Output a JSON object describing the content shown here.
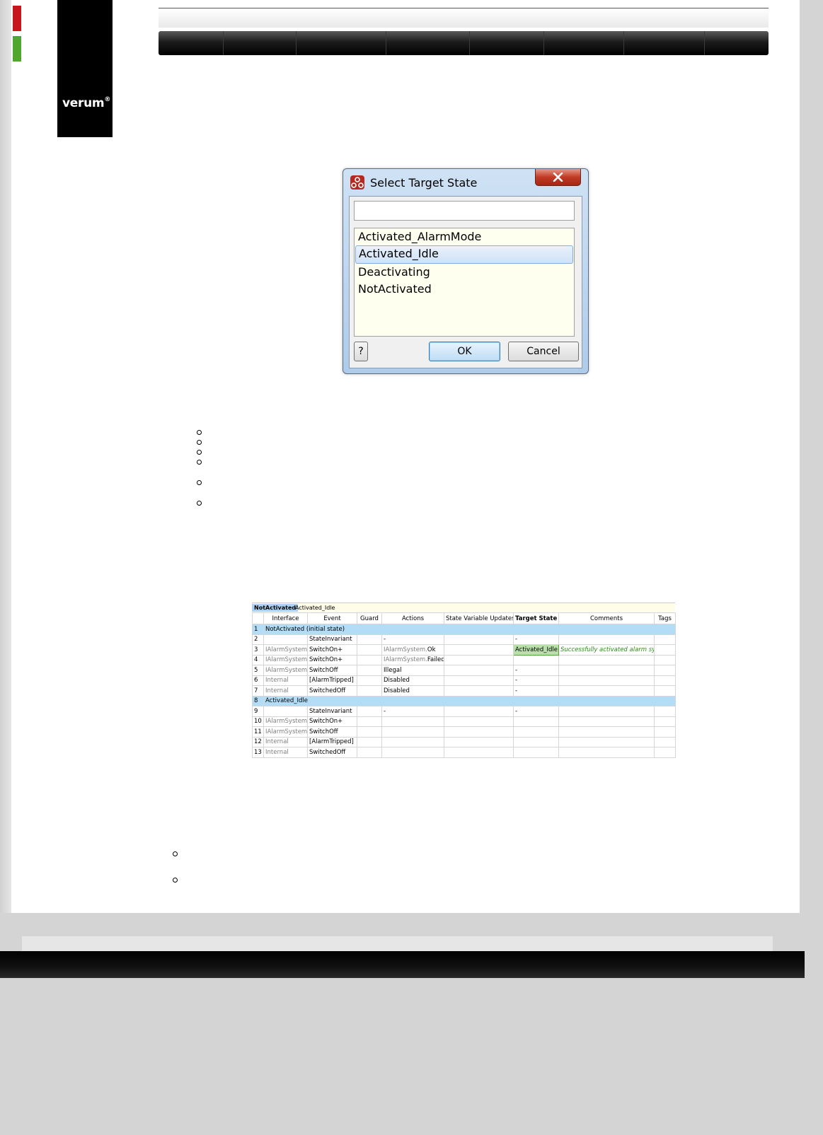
{
  "brand": {
    "logo_text": "verum",
    "logo_reg": "®"
  },
  "dialog": {
    "title": "Select Target State",
    "search_value": "",
    "states": [
      "Activated_AlarmMode",
      "Activated_Idle",
      "Deactivating",
      "NotActivated"
    ],
    "selected_state": "Activated_Idle",
    "help_label": "?",
    "ok_label": "OK",
    "cancel_label": "Cancel"
  },
  "sheet": {
    "tabs": [
      "NotActivated",
      "Activated_Idle"
    ],
    "columns": [
      "",
      "Interface",
      "Event",
      "Guard",
      "Actions",
      "State Variable Updates",
      "Target State",
      "Comments",
      "Tags"
    ],
    "rows": [
      {
        "num": "1",
        "section": "NotActivated (initial state)"
      },
      {
        "num": "2",
        "interface": "",
        "event": "StateInvariant",
        "guard": "",
        "actions": "-",
        "actions_prefix": "",
        "svu": "",
        "target": "-",
        "comment": "",
        "tags": ""
      },
      {
        "num": "3",
        "interface": "IAlarmSystem",
        "event": "SwitchOn+",
        "guard": "",
        "actions_prefix": "IAlarmSystem.",
        "actions": "Ok",
        "svu": "",
        "target": "Activated_Idle",
        "target_highlight": true,
        "comment": "Successfully activated alarm system",
        "tags": ""
      },
      {
        "num": "4",
        "interface": "IAlarmSystem",
        "event": "SwitchOn+",
        "guard": "",
        "actions_prefix": "IAlarmSystem.",
        "actions": "Failed",
        "svu": "",
        "target": "",
        "comment": "",
        "tags": ""
      },
      {
        "num": "5",
        "interface": "IAlarmSystem",
        "event": "SwitchOff",
        "guard": "",
        "actions_prefix": "",
        "actions": "Illegal",
        "svu": "",
        "target": "-",
        "comment": "",
        "tags": ""
      },
      {
        "num": "6",
        "interface": "Internal",
        "event": "[AlarmTripped]",
        "guard": "",
        "actions_prefix": "",
        "actions": "Disabled",
        "svu": "",
        "target": "-",
        "comment": "",
        "tags": ""
      },
      {
        "num": "7",
        "interface": "Internal",
        "event": "SwitchedOff",
        "guard": "",
        "actions_prefix": "",
        "actions": "Disabled",
        "svu": "",
        "target": "-",
        "comment": "",
        "tags": ""
      },
      {
        "num": "8",
        "section": "Activated_Idle"
      },
      {
        "num": "9",
        "interface": "",
        "event": "StateInvariant",
        "guard": "",
        "actions_prefix": "",
        "actions": "-",
        "svu": "",
        "target": "-",
        "comment": "",
        "tags": ""
      },
      {
        "num": "10",
        "interface": "IAlarmSystem",
        "event": "SwitchOn+",
        "guard": "",
        "actions_prefix": "",
        "actions": "",
        "svu": "",
        "target": "",
        "comment": "",
        "tags": ""
      },
      {
        "num": "11",
        "interface": "IAlarmSystem",
        "event": "SwitchOff",
        "guard": "",
        "actions_prefix": "",
        "actions": "",
        "svu": "",
        "target": "",
        "comment": "",
        "tags": ""
      },
      {
        "num": "12",
        "interface": "Internal",
        "event": "[AlarmTripped]",
        "guard": "",
        "actions_prefix": "",
        "actions": "",
        "svu": "",
        "target": "",
        "comment": "",
        "tags": ""
      },
      {
        "num": "13",
        "interface": "Internal",
        "event": "SwitchedOff",
        "guard": "",
        "actions_prefix": "",
        "actions": "",
        "svu": "",
        "target": "",
        "comment": "",
        "tags": ""
      }
    ]
  },
  "colors": {
    "accent_red": "#c8161d",
    "accent_green": "#4fa82d",
    "section_blue": "#b3dcf7",
    "target_green": "#b8e0a8"
  }
}
